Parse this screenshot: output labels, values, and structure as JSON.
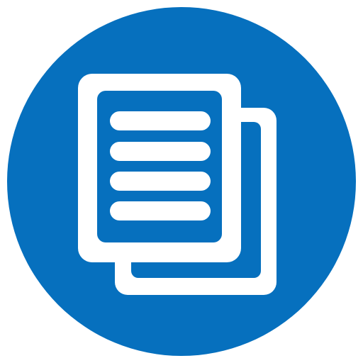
{
  "icon": {
    "name": "documents-copy-icon",
    "colors": {
      "circle": "#0670BE",
      "glyph": "#ffffff"
    }
  }
}
